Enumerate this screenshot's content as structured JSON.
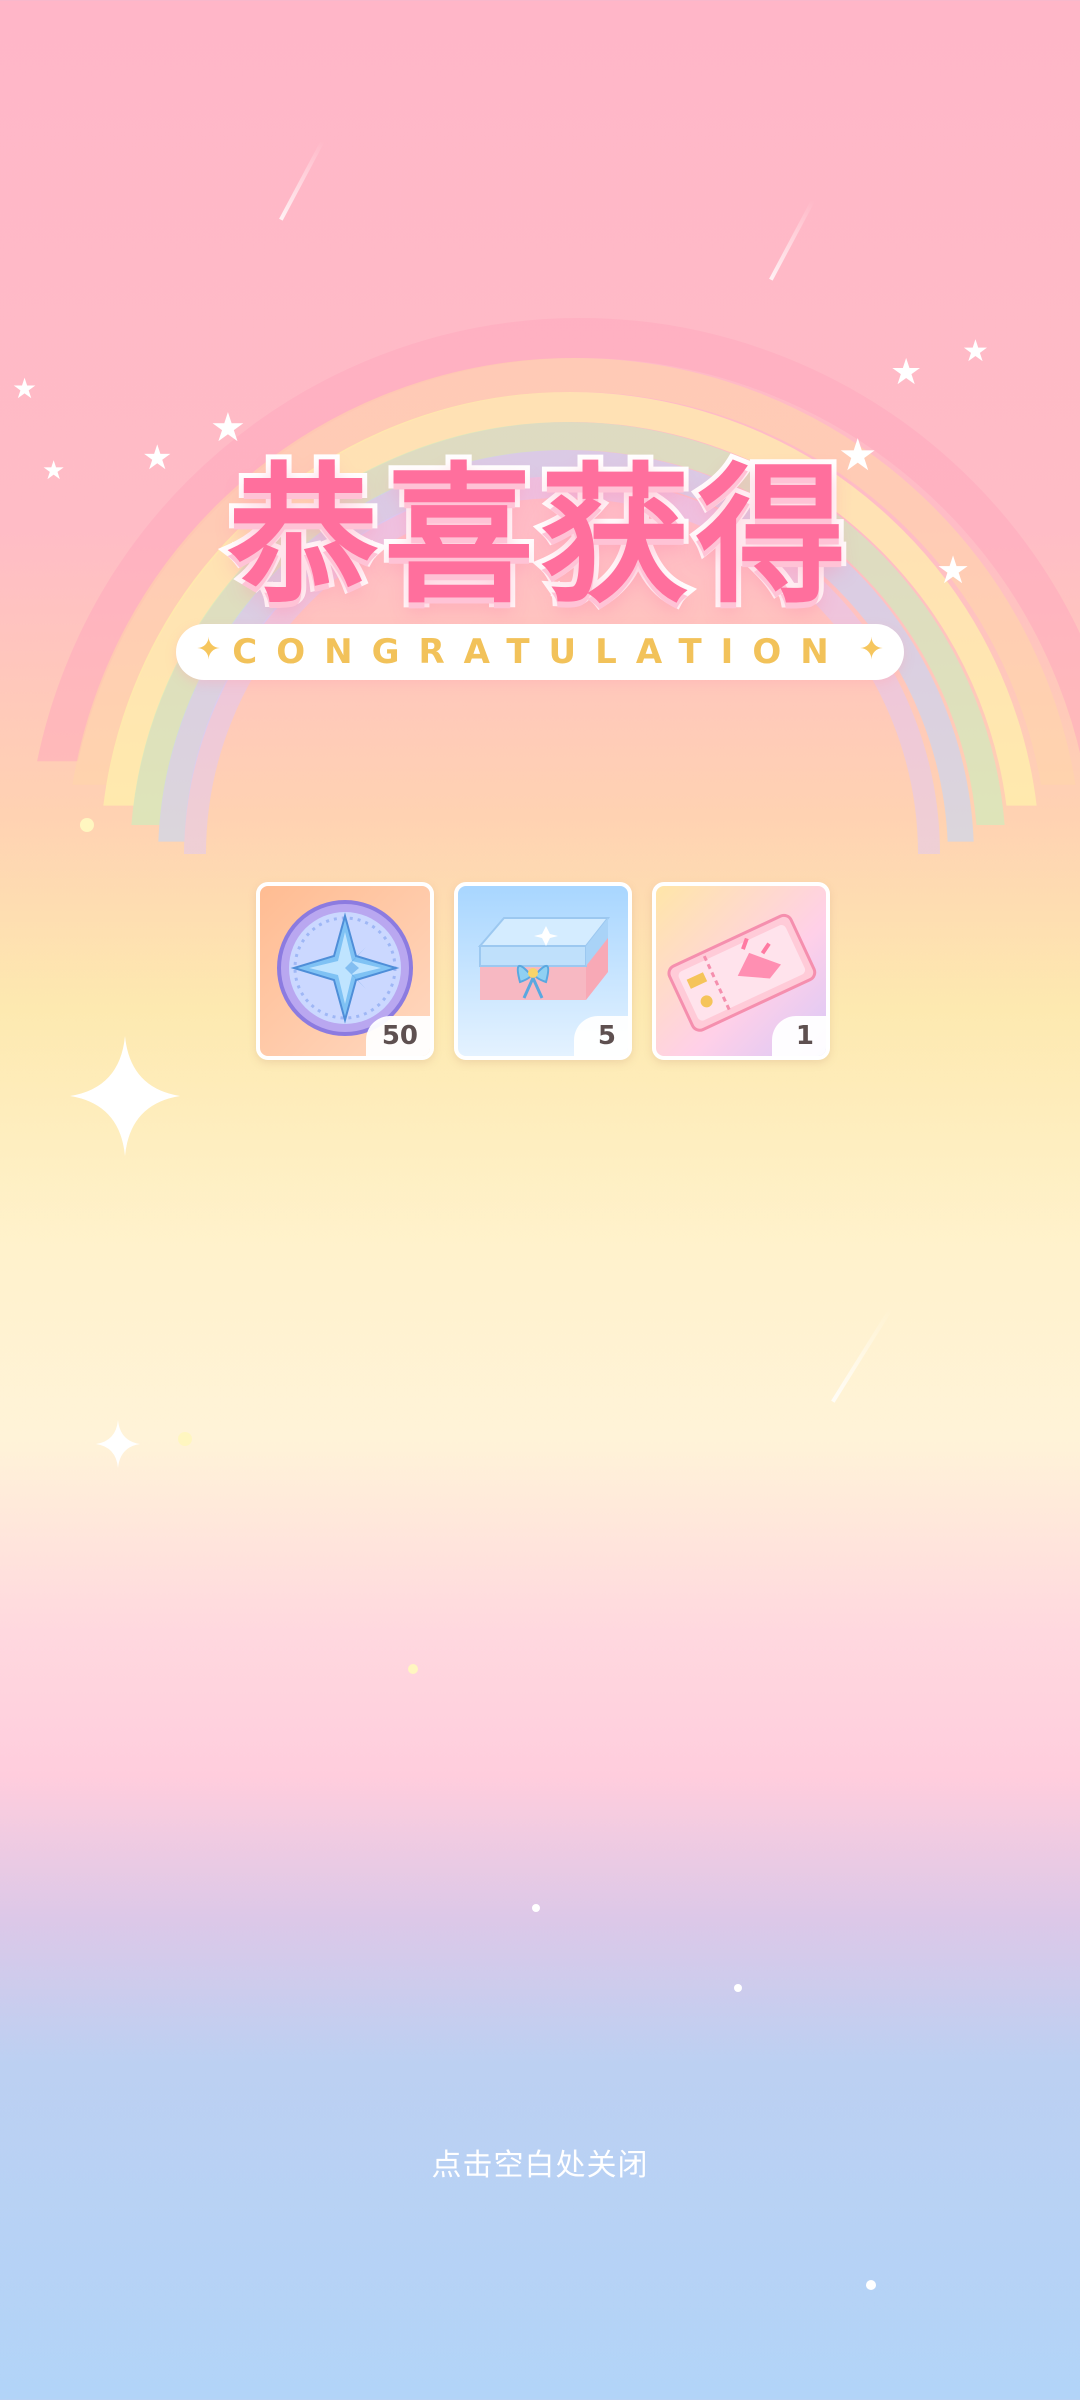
{
  "header": {
    "title": "恭喜获得",
    "subtitle": "CONGRATULATION"
  },
  "rewards": [
    {
      "name": "compass-medal",
      "icon": "star-medal-icon",
      "count": "50",
      "bg": "#ffc7a4"
    },
    {
      "name": "gift-box",
      "icon": "gift-box-icon",
      "count": "5",
      "bg": "#bfe0fb"
    },
    {
      "name": "ticket",
      "icon": "ticket-icon",
      "count": "1",
      "bg": "#fbd5ea"
    }
  ],
  "footer": {
    "hint": "点击空白处关闭"
  },
  "colors": {
    "title": "#ff6f9d",
    "subtitle": "#f2c25a",
    "background_top": "#ffb6c8",
    "background_bottom": "#b2d4f8"
  }
}
